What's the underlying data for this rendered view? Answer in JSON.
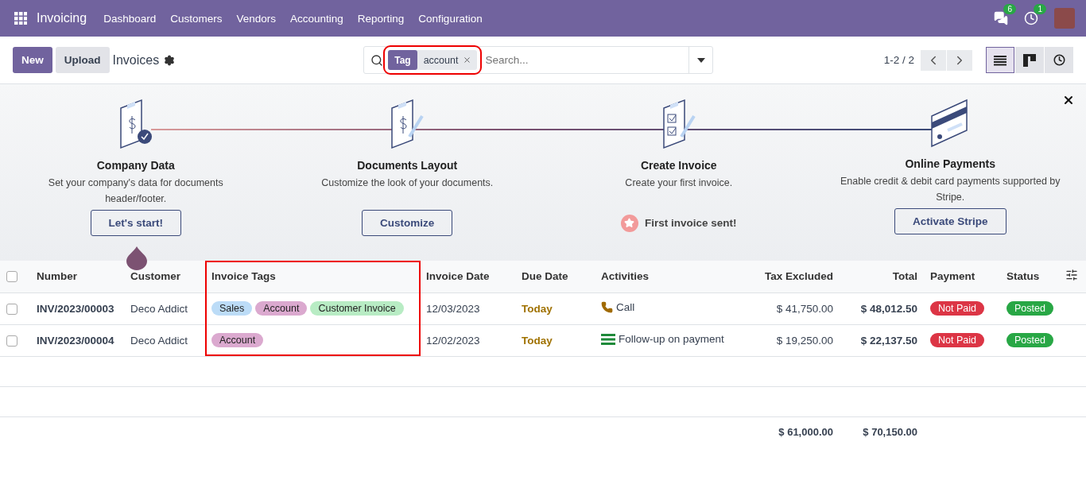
{
  "navbar": {
    "app": "Invoicing",
    "menu": [
      "Dashboard",
      "Customers",
      "Vendors",
      "Accounting",
      "Reporting",
      "Configuration"
    ],
    "messages_count": "6",
    "activities_count": "1"
  },
  "control_panel": {
    "new_button": "New",
    "upload_button": "Upload",
    "title": "Invoices",
    "search": {
      "facet": {
        "label": "Tag",
        "value": "account"
      },
      "placeholder": "Search..."
    },
    "pager": "1-2 / 2",
    "views": [
      {
        "kind": "list",
        "selected": true
      },
      {
        "kind": "kanban",
        "selected": false
      },
      {
        "kind": "activity",
        "selected": false
      }
    ]
  },
  "onboarding": {
    "steps": [
      {
        "kind": "company",
        "title": "Company Data",
        "description": "Set your company's data for documents header/footer.",
        "action": {
          "kind": "button",
          "label": "Let's start!"
        }
      },
      {
        "kind": "layout",
        "title": "Documents Layout",
        "description": "Customize the look of your documents.",
        "action": {
          "kind": "button",
          "label": "Customize"
        }
      },
      {
        "kind": "invoice",
        "title": "Create Invoice",
        "description": "Create your first invoice.",
        "action": {
          "kind": "done",
          "label": "First invoice sent!"
        }
      },
      {
        "kind": "payment",
        "title": "Online Payments",
        "description": "Enable credit & debit card payments supported by Stripe.",
        "action": {
          "kind": "button",
          "label": "Activate Stripe"
        }
      }
    ]
  },
  "table": {
    "select_all_checked": false,
    "columns": [
      "Number",
      "Customer",
      "Invoice Tags",
      "Invoice Date",
      "Due Date",
      "Activities",
      "Tax Excluded",
      "Total",
      "Payment",
      "Status"
    ],
    "rows": [
      {
        "checked": false,
        "number": "INV/2023/00003",
        "customer": "Deco Addict",
        "tags": [
          {
            "label": "Sales",
            "color": "#bcdcf7"
          },
          {
            "label": "Account",
            "color": "#dba9cf"
          },
          {
            "label": "Customer Invoice",
            "color": "#b8ecc4"
          }
        ],
        "invoice_date": "12/03/2023",
        "due_date": "Today",
        "activity": {
          "kind": "call",
          "label": "Call"
        },
        "tax_excluded": "$ 41,750.00",
        "total": "$ 48,012.50",
        "payment": {
          "kind": "danger",
          "label": "Not Paid"
        },
        "status": {
          "kind": "success",
          "label": "Posted"
        }
      },
      {
        "checked": false,
        "number": "INV/2023/00004",
        "customer": "Deco Addict",
        "tags": [
          {
            "label": "Account",
            "color": "#dba9cf"
          }
        ],
        "invoice_date": "12/02/2023",
        "due_date": "Today",
        "activity": {
          "kind": "todo",
          "label": "Follow-up on payment"
        },
        "tax_excluded": "$ 19,250.00",
        "total": "$ 22,137.50",
        "payment": {
          "kind": "danger",
          "label": "Not Paid"
        },
        "status": {
          "kind": "success",
          "label": "Posted"
        }
      }
    ],
    "totals": {
      "tax_excluded": "$ 61,000.00",
      "total": "$ 70,150.00"
    }
  }
}
